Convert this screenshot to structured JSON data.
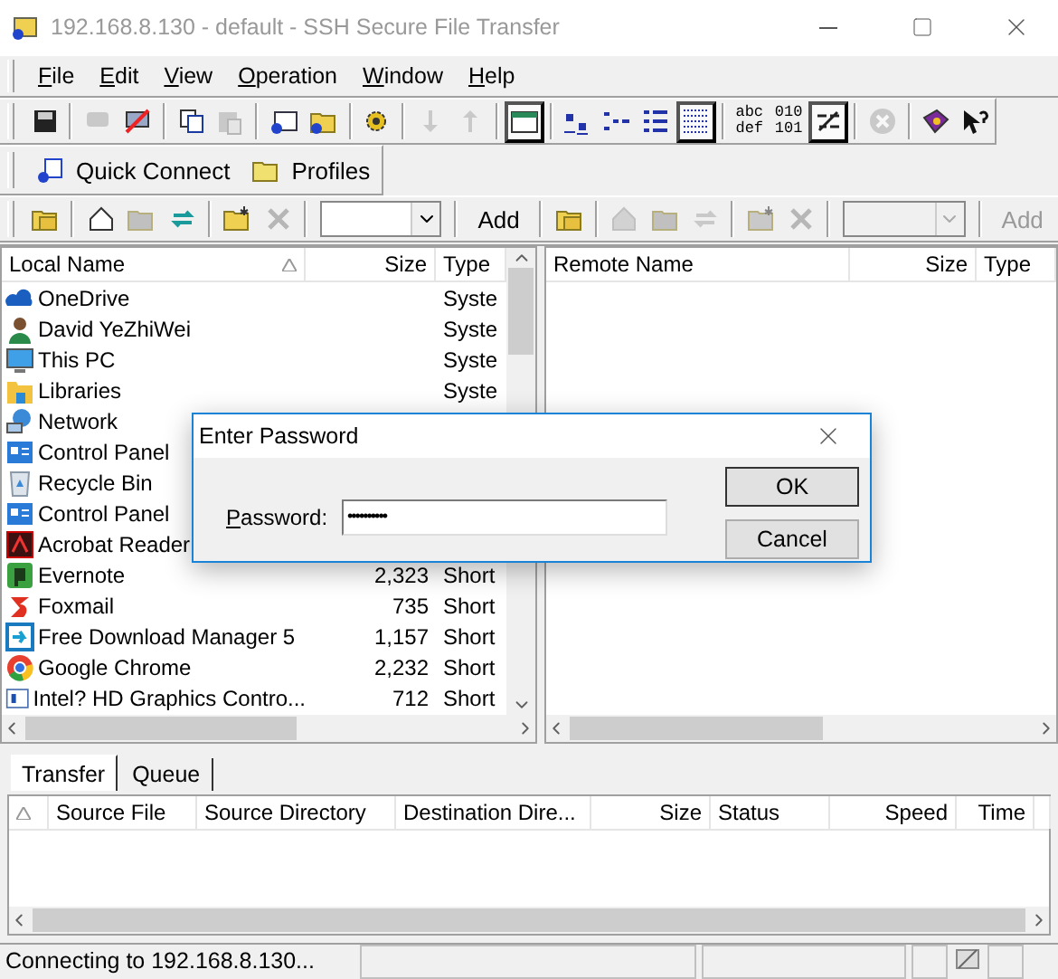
{
  "window": {
    "title": "192.168.8.130 - default - SSH Secure File Transfer"
  },
  "menu": [
    "File",
    "Edit",
    "View",
    "Operation",
    "Window",
    "Help"
  ],
  "toolbar": {
    "groups": [
      [
        {
          "disabled": false
        }
      ],
      [
        {
          "disabled": true
        },
        {
          "disabled": false
        }
      ],
      [
        {
          "disabled": false
        },
        {
          "disabled": true
        }
      ],
      [
        {
          "disabled": false
        },
        {
          "disabled": false
        }
      ],
      [
        {
          "disabled": false
        }
      ],
      [
        {
          "disabled": true
        },
        {
          "disabled": true
        }
      ],
      [
        {
          "disabled": false,
          "pressed": true
        }
      ],
      [
        {
          "disabled": false,
          "pressed": false
        },
        {
          "disabled": false,
          "pressed": false
        },
        {
          "disabled": false,
          "pressed": false
        },
        {
          "disabled": false,
          "pressed": true
        }
      ],
      [
        {
          "disabled": false,
          "pressed": false,
          "label": [
            "abc",
            "def"
          ]
        },
        {
          "disabled": false,
          "pressed": false,
          "label": [
            "010",
            "101"
          ]
        },
        {
          "disabled": false,
          "pressed": true
        }
      ],
      [
        {
          "disabled": true
        }
      ],
      [
        {
          "disabled": false
        },
        {
          "disabled": false
        }
      ]
    ]
  },
  "connect_bar": [
    "Quick Connect",
    "Profiles"
  ],
  "local_toolbar": {
    "groups": [
      [
        {
          "disabled": false
        }
      ],
      [
        {
          "disabled": false
        },
        {
          "disabled": true
        },
        {
          "disabled": false
        }
      ],
      [
        {
          "disabled": false
        },
        {
          "disabled": true
        }
      ]
    ],
    "combo_disabled": false,
    "add": {
      "label": "Add",
      "disabled": false
    }
  },
  "remote_toolbar": {
    "groups": [
      [
        {
          "disabled": false
        }
      ],
      [
        {
          "disabled": true
        },
        {
          "disabled": true
        },
        {
          "disabled": true
        }
      ],
      [
        {
          "disabled": true
        },
        {
          "disabled": true
        }
      ]
    ],
    "combo_disabled": true,
    "add": {
      "label": "Add",
      "disabled": true
    }
  },
  "local_pane": {
    "columns": [
      "Local Name",
      "Size",
      "Type"
    ],
    "rows": [
      {
        "name": "OneDrive",
        "type": "Syste"
      },
      {
        "name": "David YeZhiWei",
        "type": "Syste"
      },
      {
        "name": "This PC",
        "type": "Syste"
      },
      {
        "name": "Libraries",
        "type": "Syste"
      },
      {
        "name": "Network"
      },
      {
        "name": "Control Panel"
      },
      {
        "name": "Recycle Bin"
      },
      {
        "name": "Control Panel"
      },
      {
        "name": "Acrobat Reader"
      },
      {
        "name": "Evernote",
        "size": "2,323",
        "type": "Short"
      },
      {
        "name": "Foxmail",
        "size": "735",
        "type": "Short"
      },
      {
        "name": "Free Download Manager 5",
        "size": "1,157",
        "type": "Short"
      },
      {
        "name": "Google Chrome",
        "size": "2,232",
        "type": "Short"
      },
      {
        "name": "Intel? HD Graphics Contro...",
        "size": "712",
        "type": "Short"
      }
    ]
  },
  "remote_pane": {
    "columns": [
      "Remote Name",
      "Size",
      "Type"
    ]
  },
  "transfer_tabs": [
    {
      "label": "Transfer",
      "selected": true
    },
    {
      "label": "Queue",
      "selected": false
    }
  ],
  "transfer_table": {
    "columns": [
      "Source File",
      "Source Directory",
      "Destination Dire...",
      "Size",
      "Status",
      "Speed",
      "Time"
    ]
  },
  "status_bar": {
    "text": "Connecting to 192.168.8.130..."
  },
  "dialog": {
    "title": "Enter Password",
    "label": "Password:",
    "value": "••••••••••",
    "buttons": [
      {
        "label": "OK",
        "default": true
      },
      {
        "label": "Cancel",
        "default": false
      }
    ]
  }
}
